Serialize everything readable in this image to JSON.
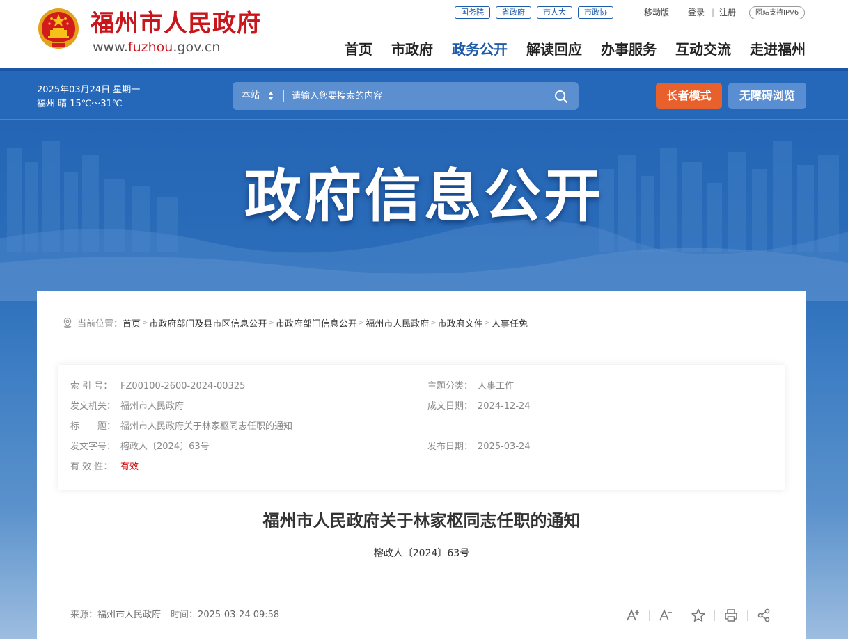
{
  "header": {
    "site_name": "福州市人民政府",
    "url_prefix": "www.",
    "url_mid": "fuzhou",
    "url_suffix": ".gov.cn",
    "top_links": [
      "国务院",
      "省政府",
      "市人大",
      "市政协"
    ],
    "mobile": "移动版",
    "login": "登录",
    "separator": "|",
    "register": "注册",
    "ipv6": "网站支持IPV6",
    "nav": [
      "首页",
      "市政府",
      "政务公开",
      "解读回应",
      "办事服务",
      "互动交流",
      "走进福州"
    ],
    "nav_active": "政务公开"
  },
  "topbar": {
    "date": "2025年03月24日 星期一",
    "weather": "福州 晴 15℃～31℃",
    "search_scope": "本站",
    "search_placeholder": "请输入您要搜索的内容",
    "elder_mode": "长者模式",
    "accessible": "无障碍浏览"
  },
  "banner": {
    "title": "政府信息公开"
  },
  "breadcrumb": {
    "label": "当前位置：",
    "items": [
      "首页",
      "市政府部门及县市区信息公开",
      "市政府部门信息公开",
      "福州市人民政府",
      "市政府文件",
      "人事任免"
    ]
  },
  "meta": {
    "index_label": "索 引 号：",
    "index_value": "FZ00100-2600-2024-00325",
    "topic_label": "主题分类：",
    "topic_value": "人事工作",
    "issuer_label": "发文机关：",
    "issuer_value": "福州市人民政府",
    "created_label": "成文日期：",
    "created_value": "2024-12-24",
    "title_label": "标　　题：",
    "title_value": "福州市人民政府关于林家枢同志任职的通知",
    "docno_label": "发文字号：",
    "docno_value": "榕政人〔2024〕63号",
    "published_label": "发布日期：",
    "published_value": "2025-03-24",
    "validity_label": "有 效 性：",
    "validity_value": "有效"
  },
  "doc": {
    "title": "福州市人民政府关于林家枢同志任职的通知",
    "number": "榕政人〔2024〕63号",
    "source_label": "来源：",
    "source_value": "福州市人民政府",
    "time_label": "时间：",
    "time_value": "2025-03-24 09:58"
  },
  "colors": {
    "brand_red": "#c8161d",
    "brand_blue": "#1e5ba8",
    "elder_orange": "#e8612c",
    "validity_red": "#d40000"
  },
  "icons": [
    "national-emblem-icon",
    "sort-arrows-icon",
    "search-icon",
    "location-pin-icon",
    "font-increase-icon",
    "font-decrease-icon",
    "star-icon",
    "print-icon",
    "share-icon"
  ]
}
